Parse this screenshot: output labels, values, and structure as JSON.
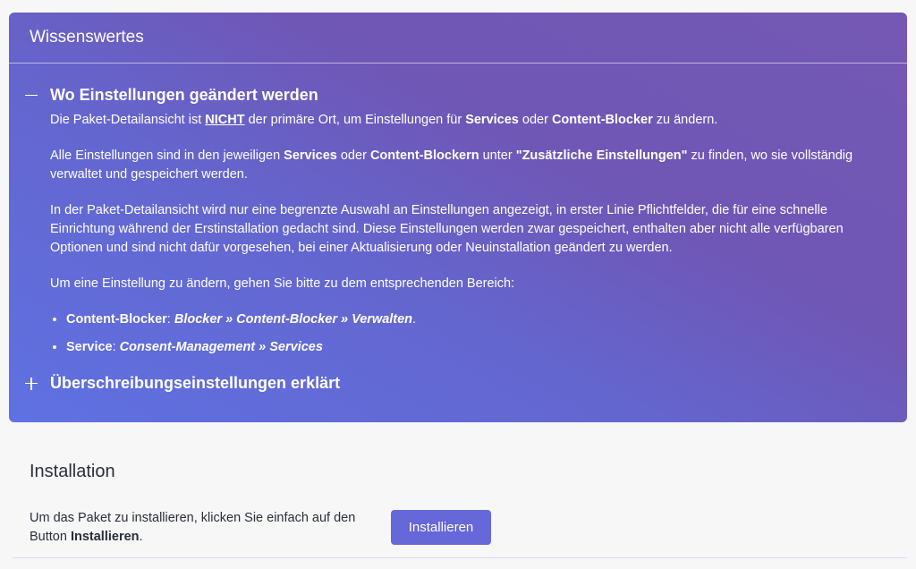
{
  "card": {
    "title": "Wissenswertes",
    "section1": {
      "title": "Wo Einstellungen geändert werden",
      "p1": {
        "a": "Die Paket-Detailansicht ist ",
        "b": "NICHT",
        "c": " der primäre Ort, um Einstellungen für ",
        "d": "Services",
        "e": " oder ",
        "f": "Content-Blocker",
        "g": " zu ändern."
      },
      "p2": {
        "a": "Alle Einstellungen sind in den jeweiligen ",
        "b": "Services",
        "c": " oder ",
        "d": "Content-Blockern",
        "e": " unter ",
        "f": "\"Zusätzliche Einstellungen\"",
        "g": " zu finden, wo sie vollständig verwaltet und gespeichert werden."
      },
      "p3": "In der Paket-Detailansicht wird nur eine begrenzte Auswahl an Einstellungen angezeigt, in erster Linie Pflichtfelder, die für eine schnelle Einrichtung während der Erstinstallation gedacht sind. Diese Einstellungen werden zwar gespeichert, enthalten aber nicht alle verfügbaren Optionen und sind nicht dafür vorgesehen, bei einer Aktualisierung oder Neuinstallation geändert zu werden.",
      "p4": "Um eine Einstellung zu ändern, gehen Sie bitte zu dem entsprechenden Bereich:",
      "list": [
        {
          "label": "Content-Blocker",
          "sep": ": ",
          "path": "Blocker » Content-Blocker » Verwalten",
          "end": "."
        },
        {
          "label": "Service",
          "sep": ": ",
          "path": "Consent-Management » Services",
          "end": ""
        }
      ]
    },
    "section2": {
      "title": "Überschreibungseinstellungen erklärt"
    }
  },
  "installation": {
    "title": "Installation",
    "text_a": "Um das Paket zu installieren, klicken Sie einfach auf den Button ",
    "text_b": "Installieren",
    "text_c": ".",
    "button_label": "Installieren"
  },
  "colors": {
    "accent": "#6667d8",
    "card_gradient_top": "#7458b4",
    "card_gradient_bottom": "#5f71e2"
  },
  "icons": {
    "collapse": "minus-icon",
    "expand": "plus-icon"
  }
}
